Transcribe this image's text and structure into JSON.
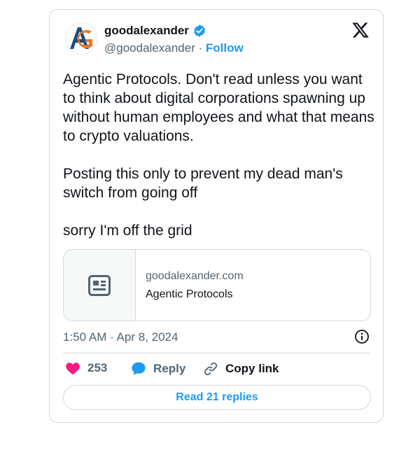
{
  "tweet": {
    "author": {
      "display_name": "goodalexander",
      "handle": "@goodalexander",
      "separator": "·",
      "follow_label": "Follow",
      "verified": true
    },
    "body": {
      "paragraph_1": "Agentic Protocols. Don't read unless you want to think about digital corporations spawning up without human employees and what that means to crypto valuations.",
      "paragraph_2": "Posting this only to prevent my dead man's switch from going off",
      "paragraph_3": "sorry I'm off the grid"
    },
    "link_card": {
      "domain": "goodalexander.com",
      "title": "Agentic Protocols",
      "icon": "article-icon"
    },
    "timestamp": "1:50 AM · Apr 8, 2024",
    "actions": {
      "like_count": "253",
      "reply_label": "Reply",
      "copy_link_label": "Copy link"
    },
    "read_replies_label": "Read 21 replies"
  },
  "colors": {
    "accent": "#1d9bf0",
    "like": "#f91880",
    "text_primary": "#0f1419",
    "text_secondary": "#536471",
    "border": "#cfd9de"
  }
}
